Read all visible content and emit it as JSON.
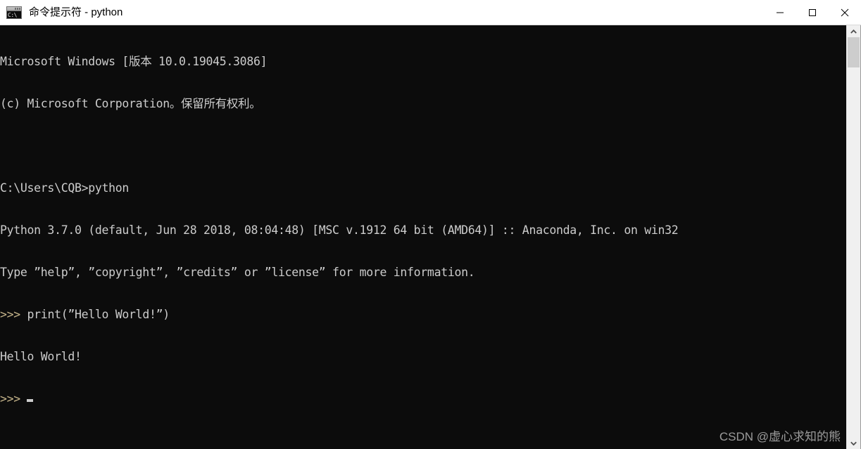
{
  "window": {
    "title": "命令提示符 - python",
    "icon": "cmd-icon",
    "icon_text": "C:\\",
    "controls": [
      {
        "name": "minimize-button",
        "label": "—"
      },
      {
        "name": "maximize-button",
        "label": "□"
      },
      {
        "name": "close-button",
        "label": "✕"
      }
    ]
  },
  "terminal": {
    "background_color": "#0c0c0c",
    "text_color": "#cccccc",
    "prompt_color": "#c5b48a",
    "lines": [
      {
        "text": "Microsoft Windows [版本 10.0.19045.3086]",
        "type": "output"
      },
      {
        "text": "(c) Microsoft Corporation。保留所有权利。",
        "type": "output"
      },
      {
        "text": "",
        "type": "blank"
      },
      {
        "text": "C:\\Users\\CQB>python",
        "type": "command"
      },
      {
        "text": "Python 3.7.0 (default, Jun 28 2018, 08:04:48) [MSC v.1912 64 bit (AMD64)] :: Anaconda, Inc. on win32",
        "type": "output"
      },
      {
        "text": "Type ”help”, ”copyright”, ”credits” or ”license” for more information.",
        "type": "output"
      },
      {
        "prompt": ">>>",
        "text": " print(”Hello World!”)",
        "type": "python-input"
      },
      {
        "text": "Hello World!",
        "type": "output"
      },
      {
        "prompt": ">>>",
        "text": "",
        "type": "python-prompt",
        "cursor": true
      }
    ]
  },
  "watermark": {
    "text": "CSDN @虚心求知的熊",
    "color": "#9b9b9b"
  },
  "scrollbar": {
    "up_arrow": "chevron-up-icon",
    "down_arrow": "chevron-down-icon",
    "thumb_color": "#cdcdcd",
    "track_color": "#f0f0f0"
  }
}
